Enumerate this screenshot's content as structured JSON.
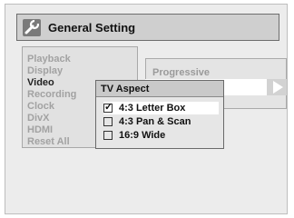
{
  "header": {
    "title": "General Setting",
    "icon": "wrench-icon"
  },
  "menu": {
    "items": [
      {
        "label": "Playback",
        "active": false
      },
      {
        "label": "Display",
        "active": false
      },
      {
        "label": "Video",
        "active": true
      },
      {
        "label": "Recording",
        "active": false
      },
      {
        "label": "Clock",
        "active": false
      },
      {
        "label": "DivX",
        "active": false
      },
      {
        "label": "HDMI",
        "active": false
      },
      {
        "label": "Reset All",
        "active": false
      }
    ]
  },
  "submenu": {
    "title": "Progressive",
    "arrow_icon": "arrow-right-icon"
  },
  "popup": {
    "title": "TV Aspect",
    "options": [
      {
        "label": "4:3 Letter Box",
        "checked": true
      },
      {
        "label": "4:3 Pan & Scan",
        "checked": false
      },
      {
        "label": "16:9 Wide",
        "checked": false
      }
    ]
  }
}
